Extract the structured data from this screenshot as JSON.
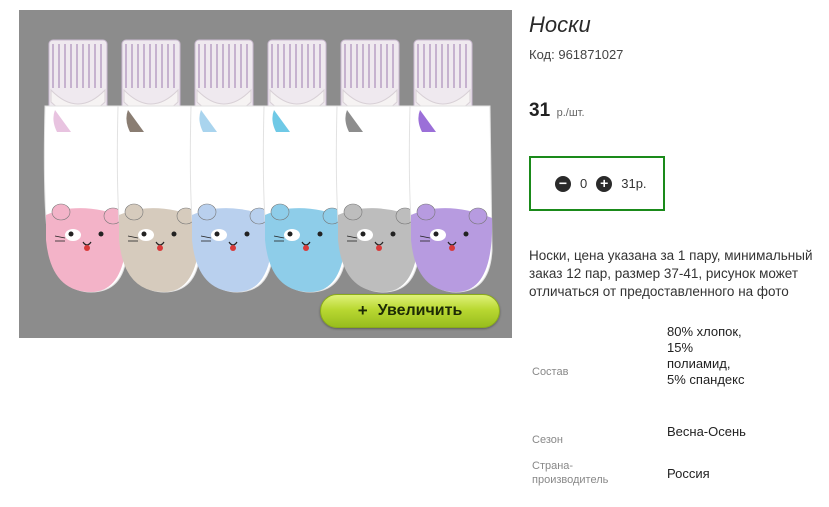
{
  "product": {
    "title": "Носки",
    "code_label": "Код:",
    "code_value": "961871027",
    "price_value": "31",
    "price_unit": "р./шт."
  },
  "quantity": {
    "minus_icon": "minus-circle-icon",
    "plus_icon": "plus-circle-icon",
    "value": "0",
    "sum": "31р."
  },
  "zoom": {
    "plus": "+",
    "label": "Увеличить"
  },
  "description": "Носки, цена указана за 1 пару, минимальный заказ 12 пар, размер 37-41, рисунок может отличаться от предоставленного на фото",
  "properties": [
    {
      "label": "Состав",
      "value": "80% хлопок, 15% полиамид, 5% спандекс"
    },
    {
      "label": "Сезон",
      "value": "Весна-Осень"
    },
    {
      "label": "Страна-производитель",
      "value": "Россия"
    }
  ],
  "photo": {
    "sock_colors": [
      "#f3b3c8",
      "#d6cbbd",
      "#b9d0ee",
      "#8ecde9",
      "#bdbdbd",
      "#b79be0"
    ],
    "heel_colors": [
      "#e8c3e0",
      "#8a7d72",
      "#a9d4ee",
      "#6fc9e6",
      "#8d8d8d",
      "#9b6fd8"
    ],
    "accent": "#a8c934",
    "frame_border": "#2a8a2a"
  }
}
